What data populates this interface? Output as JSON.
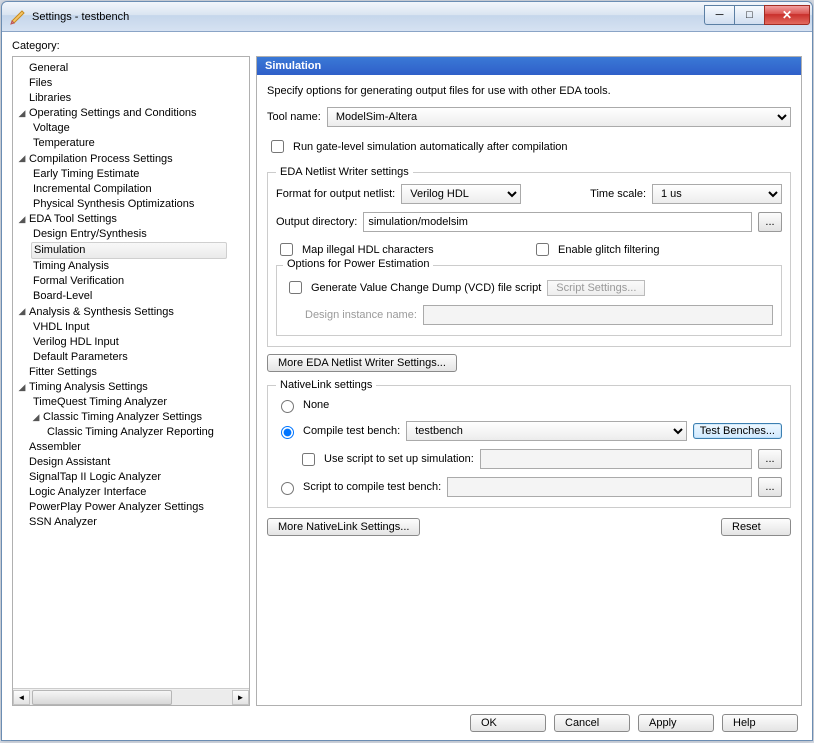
{
  "window": {
    "title": "Settings - testbench"
  },
  "category_label": "Category:",
  "tree": {
    "items": [
      "General",
      "Files",
      "Libraries",
      "Operating Settings and Conditions",
      "Voltage",
      "Temperature",
      "Compilation Process Settings",
      "Early Timing Estimate",
      "Incremental Compilation",
      "Physical Synthesis Optimizations",
      "EDA Tool Settings",
      "Design Entry/Synthesis",
      "Simulation",
      "Timing Analysis",
      "Formal Verification",
      "Board-Level",
      "Analysis & Synthesis Settings",
      "VHDL Input",
      "Verilog HDL Input",
      "Default Parameters",
      "Fitter Settings",
      "Timing Analysis Settings",
      "TimeQuest Timing Analyzer",
      "Classic Timing Analyzer Settings",
      "Classic Timing Analyzer Reporting",
      "Assembler",
      "Design Assistant",
      "SignalTap II Logic Analyzer",
      "Logic Analyzer Interface",
      "PowerPlay Power Analyzer Settings",
      "SSN Analyzer"
    ]
  },
  "pane": {
    "title": "Simulation",
    "description": "Specify options for generating output files for use with other EDA tools.",
    "tool_name_label": "Tool name:",
    "tool_name_value": "ModelSim-Altera",
    "run_gate_label": "Run gate-level simulation automatically after compilation",
    "eda_group": "EDA Netlist Writer settings",
    "format_label": "Format for output netlist:",
    "format_value": "Verilog HDL",
    "timescale_label": "Time scale:",
    "timescale_value": "1 us",
    "outdir_label": "Output directory:",
    "outdir_value": "simulation/modelsim",
    "map_illegal": "Map illegal HDL characters",
    "enable_glitch": "Enable glitch filtering",
    "power_group": "Options for Power Estimation",
    "gen_vcd": "Generate Value Change Dump (VCD) file script",
    "script_settings_btn": "Script Settings...",
    "design_instance_label": "Design instance name:",
    "more_eda_btn": "More EDA Netlist Writer Settings...",
    "native_group": "NativeLink settings",
    "radio_none": "None",
    "radio_compile": "Compile test bench:",
    "compile_value": "testbench",
    "test_benches_btn": "Test Benches...",
    "use_script_label": "Use script to set up simulation:",
    "radio_script": "Script to compile test bench:",
    "more_native_btn": "More NativeLink Settings...",
    "reset_btn": "Reset",
    "browse": "..."
  },
  "buttons": {
    "ok": "OK",
    "cancel": "Cancel",
    "apply": "Apply",
    "help": "Help"
  }
}
